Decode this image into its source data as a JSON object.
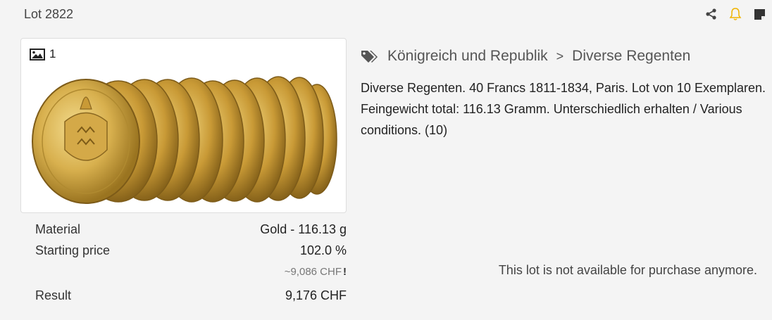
{
  "lot": {
    "label": "Lot 2822"
  },
  "header_actions": [
    {
      "icon": "share-icon"
    },
    {
      "icon": "bell-icon",
      "color": "#f0b400"
    },
    {
      "icon": "note-icon"
    }
  ],
  "gallery": {
    "count": "1"
  },
  "breadcrumb": {
    "parent": "Königreich und Republik",
    "separator": ">",
    "current": "Diverse Regenten"
  },
  "description": "Diverse Regenten. 40 Francs 1811-1834, Paris. Lot von 10 Exemplaren. Feingewicht total: 116.13 Gramm. Unterschiedlich erhalten / Various conditions. (10)",
  "details": {
    "material_label": "Material",
    "material_value": "Gold - 116.13 g",
    "starting_label": "Starting price",
    "starting_value": "102.0 %",
    "starting_approx": "~9,086 CHF",
    "starting_warn": "!",
    "result_label": "Result",
    "result_value": "9,176 CHF"
  },
  "status": {
    "message": "This lot is not available for purchase anymore."
  }
}
